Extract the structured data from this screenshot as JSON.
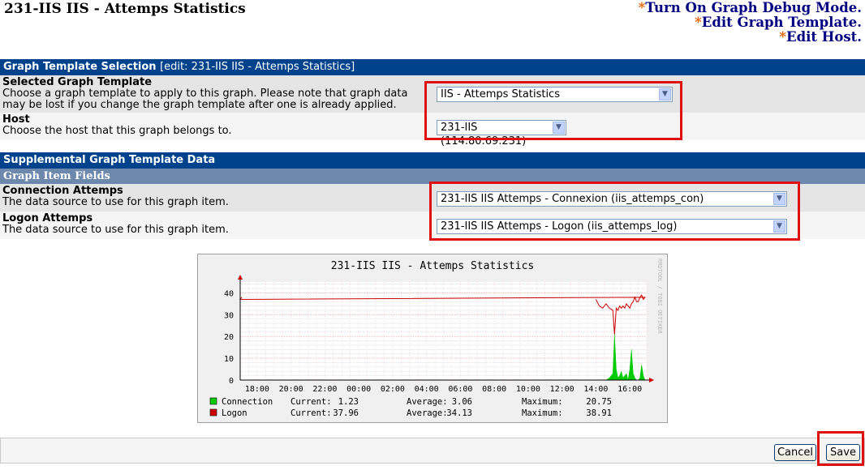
{
  "page": {
    "title": "231-IIS IIS - Attemps Statistics"
  },
  "top_links": [
    {
      "star": "*",
      "label": "Turn On Graph Debug Mode."
    },
    {
      "star": "*",
      "label": "Edit Graph Template."
    },
    {
      "star": "*",
      "label": "Edit Host."
    }
  ],
  "template_section": {
    "title": "Graph Template Selection",
    "edit_text": "[edit: 231-IIS IIS - Attemps Statistics]",
    "rows": [
      {
        "label": "Selected Graph Template",
        "desc": "Choose a graph template to apply to this graph. Please note that graph data may be lost if you change the graph template after one is already applied.",
        "value": "IIS - Attemps Statistics"
      },
      {
        "label": "Host",
        "desc": "Choose the host that this graph belongs to.",
        "value": "231-IIS (114.80.69.231)"
      }
    ]
  },
  "supplemental": {
    "title": "Supplemental Graph Template Data",
    "subtitle": "Graph Item Fields",
    "rows": [
      {
        "label": "Connection Attemps",
        "desc": "The data source to use for this graph item.",
        "value": "231-IIS IIS Attemps - Connexion (iis_attemps_con)"
      },
      {
        "label": "Logon Attemps",
        "desc": "The data source to use for this graph item.",
        "value": "231-IIS IIS Attemps - Logon (iis_attemps_log)"
      }
    ]
  },
  "chart_data": {
    "type": "area",
    "title": "231-IIS IIS - Attemps Statistics",
    "watermark": "RRDTOOL / TOBI OETIKER",
    "x_ticks": [
      "18:00",
      "20:00",
      "22:00",
      "00:00",
      "02:00",
      "04:00",
      "06:00",
      "08:00",
      "10:00",
      "12:00",
      "14:00",
      "16:00"
    ],
    "y_ticks": [
      0,
      10,
      20,
      30,
      40
    ],
    "ylim": [
      0,
      45
    ],
    "grid": true,
    "series": [
      {
        "name": "Connection",
        "color": "#00cc00",
        "hours": [
          14.0,
          14.2,
          14.4,
          14.6,
          14.8,
          15.0,
          15.1,
          15.2,
          15.3,
          15.4,
          15.5,
          15.6,
          15.7,
          15.8,
          15.9,
          16.0,
          16.1,
          16.2,
          16.3,
          16.4,
          16.5,
          16.6,
          16.7,
          16.8,
          16.9,
          17.0,
          17.1
        ],
        "values": [
          0,
          0,
          0,
          0,
          1,
          3,
          21,
          5,
          1,
          2,
          4,
          1,
          2,
          3,
          0,
          5,
          14,
          3,
          1,
          0,
          0,
          1,
          7,
          2,
          0,
          0,
          0
        ],
        "legend": {
          "Current:": "1.23",
          "Average:": "3.06",
          "Maximum:": "20.75"
        }
      },
      {
        "name": "Logon",
        "color": "#cc0000",
        "hours": [
          14.0,
          14.2,
          14.4,
          14.6,
          14.8,
          15.0,
          15.1,
          15.2,
          15.3,
          15.4,
          15.5,
          15.6,
          15.7,
          15.8,
          15.9,
          16.0,
          16.1,
          16.2,
          16.3,
          16.4,
          16.5,
          16.6,
          16.7,
          16.8,
          16.9,
          17.0,
          17.1
        ],
        "values": [
          37,
          34,
          33,
          35,
          33,
          32,
          21,
          33,
          32,
          34,
          33,
          34,
          33,
          35,
          34,
          33,
          35,
          36,
          38,
          36,
          36,
          38,
          39,
          37,
          38,
          37,
          38
        ],
        "legend": {
          "Current:": "37.96",
          "Average:": "34.13",
          "Maximum:": "38.91"
        }
      }
    ]
  },
  "buttons": {
    "cancel": "Cancel",
    "save": "Save"
  }
}
